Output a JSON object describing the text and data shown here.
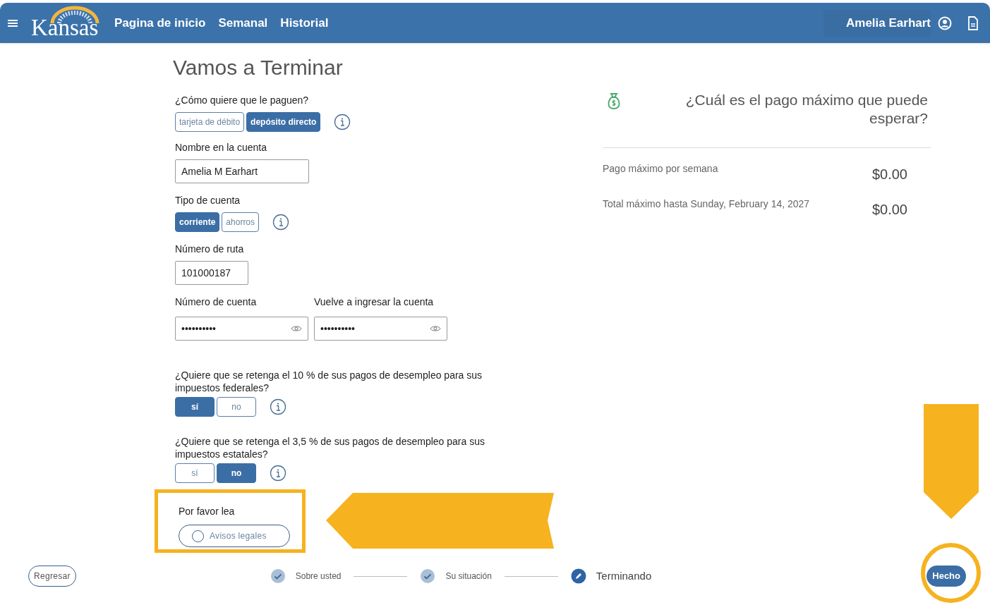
{
  "header": {
    "logo": "Kansas",
    "nav": [
      {
        "label": "Pagina de inicio"
      },
      {
        "label": "Semanal"
      },
      {
        "label": "Historial"
      }
    ],
    "user": "Amelia Earhart"
  },
  "title": "Vamos a Terminar",
  "form": {
    "payment_method": {
      "label": "¿Cómo quiere que le paguen?",
      "options": [
        {
          "label": "tarjeta de débito",
          "selected": false
        },
        {
          "label": "depósito directo",
          "selected": true
        }
      ]
    },
    "account_name": {
      "label": "Nombre en la cuenta",
      "value": "Amelia M Earhart"
    },
    "account_type": {
      "label": "Tipo de cuenta",
      "options": [
        {
          "label": "corriente",
          "selected": true
        },
        {
          "label": "ahorros",
          "selected": false
        }
      ]
    },
    "routing": {
      "label": "Número de ruta",
      "value": "101000187"
    },
    "account_number": {
      "label": "Número de cuenta",
      "value": "••••••••••"
    },
    "account_confirm": {
      "label": "Vuelve a ingresar la cuenta",
      "value": "••••••••••"
    },
    "federal_tax": {
      "label": "¿Quiere que se retenga el 10 % de sus pagos de desempleo para sus impuestos federales?",
      "options": [
        {
          "label": "sí",
          "selected": true
        },
        {
          "label": "no",
          "selected": false
        }
      ]
    },
    "state_tax": {
      "label": "¿Quiere que se retenga el 3,5 % de sus pagos de desempleo para sus impuestos estatales?",
      "options": [
        {
          "label": "sí",
          "selected": false
        },
        {
          "label": "no",
          "selected": true
        }
      ]
    },
    "legal": {
      "label": "Por favor lea",
      "button": "Avisos legales",
      "checked": false
    }
  },
  "summary": {
    "title": "¿Cuál es el pago máximo que puede esperar?",
    "rows": [
      {
        "label": "Pago máximo por semana",
        "value": "$0.00"
      },
      {
        "label": "Total máximo hasta Sunday, February 14, 2027",
        "value": "$0.00"
      }
    ]
  },
  "footer": {
    "back": "Regresar",
    "steps": [
      {
        "label": "Sobre usted",
        "kind": "done"
      },
      {
        "label": "Su situación",
        "kind": "done"
      },
      {
        "label": "Terminando",
        "kind": "current"
      }
    ],
    "done": "Hecho"
  }
}
